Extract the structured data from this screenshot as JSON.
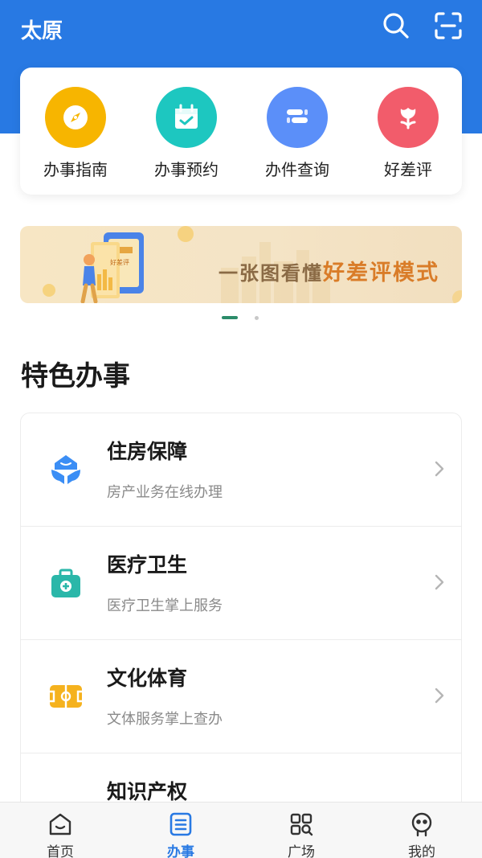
{
  "header": {
    "city": "太原",
    "search_icon": "search-icon",
    "scan_icon": "scan-icon"
  },
  "quick_actions": [
    {
      "label": "办事指南",
      "icon": "compass-icon",
      "color": "#f7b500"
    },
    {
      "label": "办事预约",
      "icon": "calendar-check-icon",
      "color": "#1dc7c0"
    },
    {
      "label": "办件查询",
      "icon": "list-query-icon",
      "color": "#5b8ff9"
    },
    {
      "label": "好差评",
      "icon": "flower-icon",
      "color": "#f25c6b"
    }
  ],
  "banner": {
    "text_prefix": "一张图看懂",
    "text_highlight": "好差评模式",
    "illustration_text": "好差评"
  },
  "carousel": {
    "current": 1,
    "total": 2
  },
  "featured": {
    "title": "特色办事",
    "items": [
      {
        "title": "住房保障",
        "subtitle": "房产业务在线办理",
        "icon": "housing-icon"
      },
      {
        "title": "医疗卫生",
        "subtitle": "医疗卫生掌上服务",
        "icon": "medical-kit-icon"
      },
      {
        "title": "文化体育",
        "subtitle": "文体服务掌上查办",
        "icon": "sports-field-icon"
      },
      {
        "title": "知识产权",
        "subtitle": "",
        "icon": "ip-icon"
      }
    ]
  },
  "tabbar": {
    "active": "办事",
    "tabs": [
      {
        "label": "首页",
        "icon": "home-icon"
      },
      {
        "label": "办事",
        "icon": "service-list-icon"
      },
      {
        "label": "广场",
        "icon": "grid-search-icon"
      },
      {
        "label": "我的",
        "icon": "profile-icon"
      }
    ]
  },
  "colors": {
    "primary": "#2879e3",
    "carousel_active": "#2c8c6a",
    "banner_highlight": "#d97c28"
  }
}
